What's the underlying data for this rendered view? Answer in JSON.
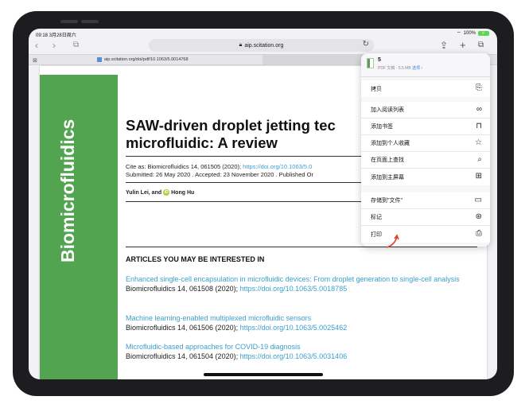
{
  "status": {
    "time": "09:18",
    "date": "3月28日周六",
    "battery": "100%"
  },
  "browser": {
    "url": "aip.scitation.org",
    "tab_url": "aip.scitation.org/doi/pdf/10.1063/5.0014768"
  },
  "pdf": {
    "journal_vertical": "Biomicrofluidics",
    "title": "SAW-driven droplet jetting tec microfluidic: A review",
    "cite_prefix": "Cite as: Biomicrofluidics 14, 061505 (2020);",
    "cite_link": "https://doi.org/10.1063/5.0",
    "submitted": "Submitted: 26 May 2020 . Accepted: 23 November 2020 . Published Or",
    "author1": "Yulin Lei, and",
    "author2": "Hong Hu",
    "articles_heading": "ARTICLES YOU MAY BE INTERESTED IN",
    "articles": [
      {
        "title": "Enhanced single-cell encapsulation in microfluidic devices: From droplet generation to single-cell analysis",
        "cite": "Biomicrofluidics 14, 061508 (2020);",
        "doi": "https://doi.org/10.1063/5.0018785"
      },
      {
        "title": "Machine learning-enabled multiplexed microfluidic sensors",
        "cite": "Biomicrofluidics 14, 061506 (2020);",
        "doi": "https://doi.org/10.1063/5.0025462"
      },
      {
        "title": "Microfluidic-based approaches for COVID-19 diagnosis",
        "cite": "Biomicrofluidics 14, 061504 (2020);",
        "doi": "https://doi.org/10.1063/5.0031406"
      }
    ]
  },
  "share": {
    "file_name": "5",
    "file_meta": "PDF 文稿 · 5.5 MB",
    "options_label": "选项 ›",
    "groups": [
      [
        {
          "label": "拷贝",
          "icon": "copy-icon"
        }
      ],
      [
        {
          "label": "加入阅读列表",
          "icon": "reading-list-icon"
        },
        {
          "label": "添加书签",
          "icon": "book-icon"
        },
        {
          "label": "添加到个人收藏",
          "icon": "star-icon"
        },
        {
          "label": "在页面上查找",
          "icon": "search-icon"
        },
        {
          "label": "添加到主屏幕",
          "icon": "add-square-icon"
        }
      ],
      [
        {
          "label": "存储到\"文件\"",
          "icon": "folder-icon"
        },
        {
          "label": "标记",
          "icon": "markup-icon"
        },
        {
          "label": "打印",
          "icon": "printer-icon"
        }
      ]
    ]
  }
}
